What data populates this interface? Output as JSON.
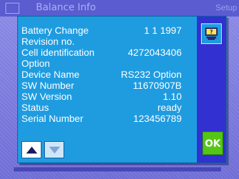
{
  "background": {
    "title": "Balance Info",
    "setup_label": "Setup"
  },
  "dialog": {
    "rows": [
      {
        "label": "Battery Change",
        "value": "1 1 1997"
      },
      {
        "label": "Revision no.",
        "value": ""
      },
      {
        "label": "Cell identification",
        "value": "4272043406"
      },
      {
        "label": "Option",
        "value": ""
      },
      {
        "label": "Device Name",
        "value": "RS232 Option"
      },
      {
        "label": "SW Number",
        "value": "11670907B"
      },
      {
        "label": "SW Version",
        "value": "1.10"
      },
      {
        "label": "Status",
        "value": "ready"
      },
      {
        "label": "Serial Number",
        "value": "123456789"
      }
    ],
    "ok_label": "OK",
    "help_icon": "help-question-icon",
    "scroll_up_icon": "arrow-up-icon",
    "scroll_down_icon": "arrow-down-icon"
  },
  "colors": {
    "dialog_bg": "#1f9ce0",
    "side_panel": "#3230d0",
    "ok_button": "#55c617",
    "text": "#ffffff"
  }
}
